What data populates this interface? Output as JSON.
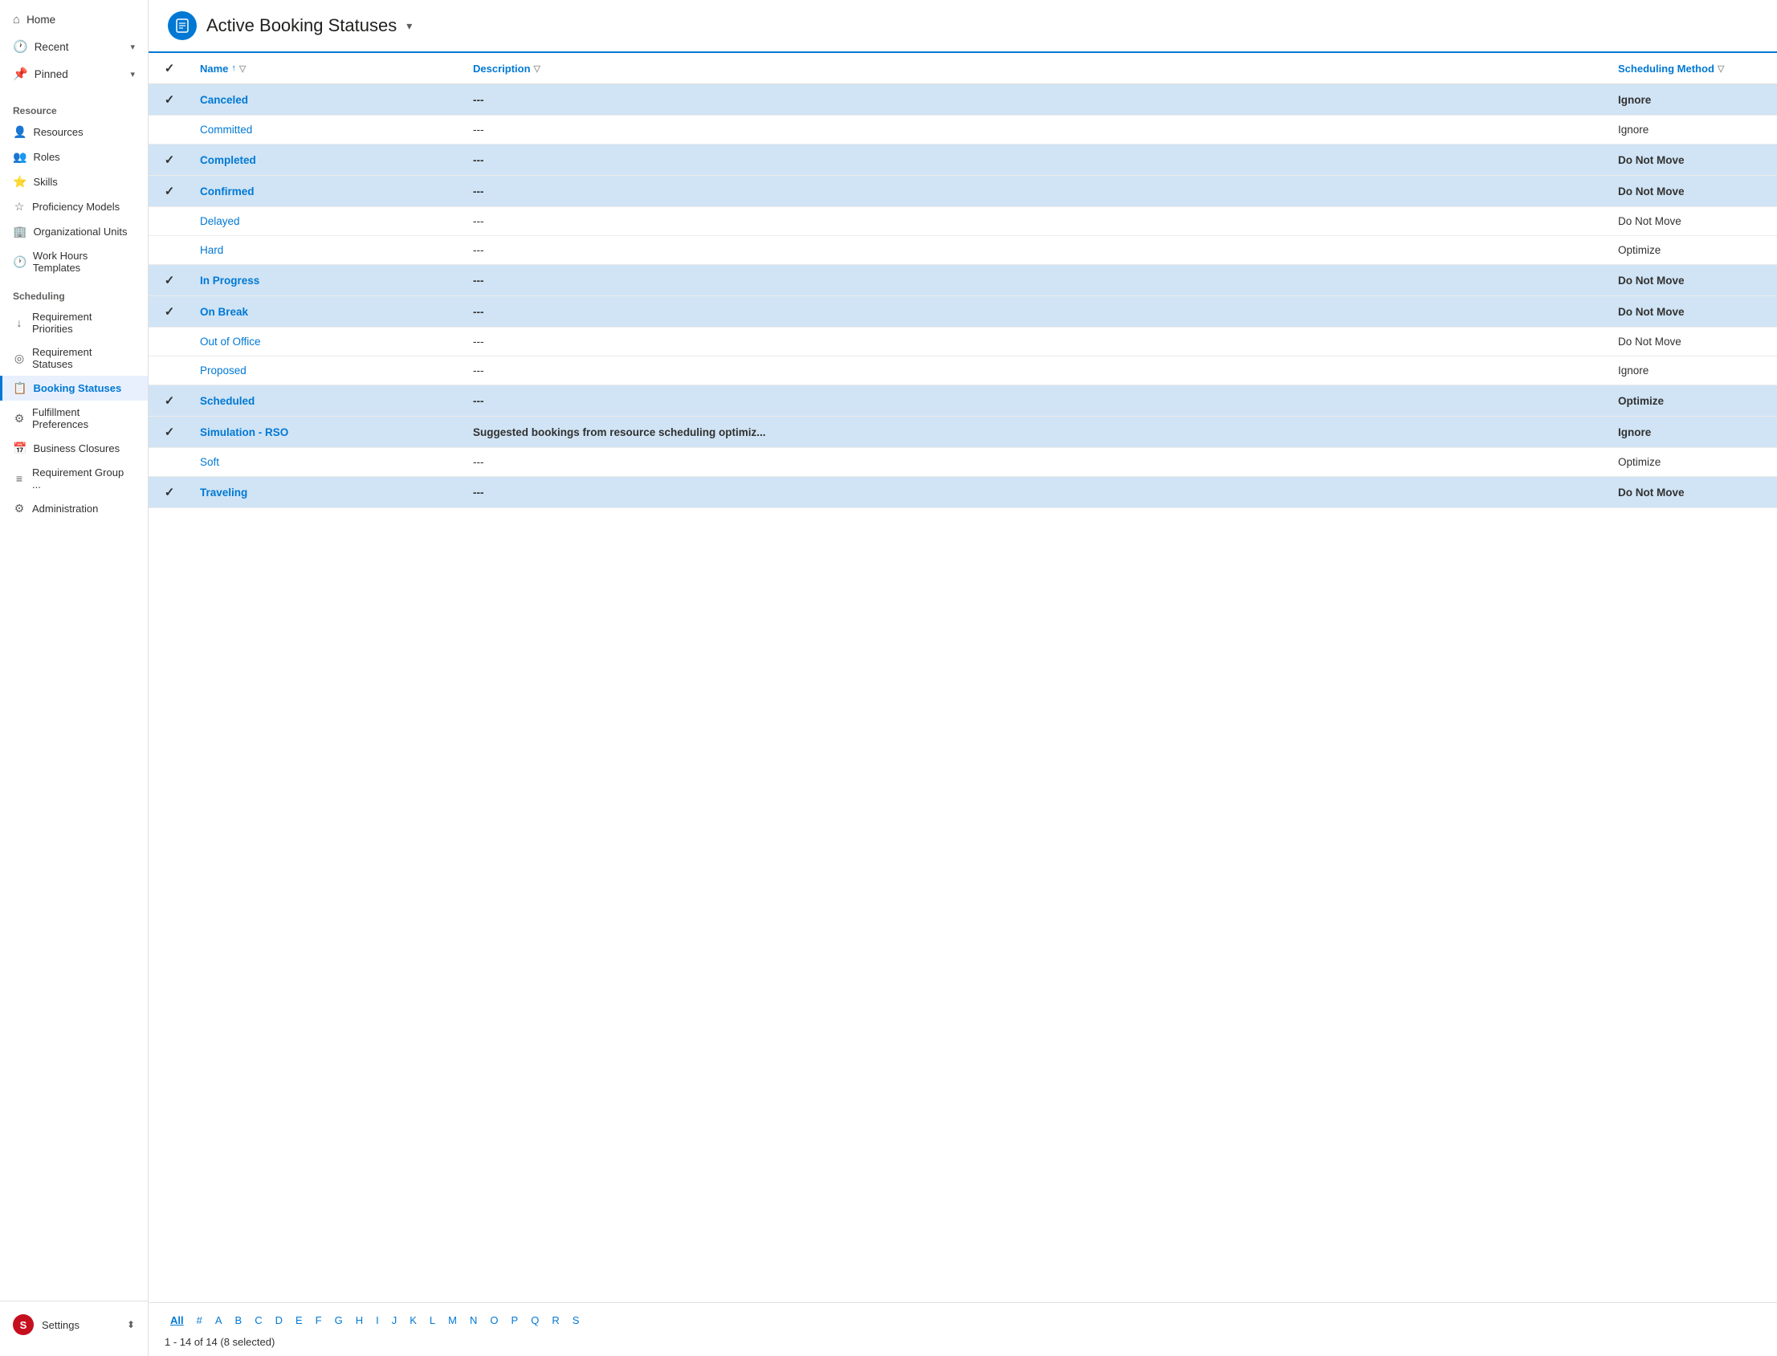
{
  "sidebar": {
    "nav": [
      {
        "id": "home",
        "label": "Home",
        "icon": "⌂",
        "hasChevron": false
      },
      {
        "id": "recent",
        "label": "Recent",
        "icon": "🕐",
        "hasChevron": true
      },
      {
        "id": "pinned",
        "label": "Pinned",
        "icon": "📌",
        "hasChevron": true
      }
    ],
    "sections": [
      {
        "id": "resource",
        "label": "Resource",
        "items": [
          {
            "id": "resources",
            "label": "Resources",
            "icon": "👤"
          },
          {
            "id": "roles",
            "label": "Roles",
            "icon": "👥"
          },
          {
            "id": "skills",
            "label": "Skills",
            "icon": "⭐"
          },
          {
            "id": "proficiency-models",
            "label": "Proficiency Models",
            "icon": "☆"
          },
          {
            "id": "organizational-units",
            "label": "Organizational Units",
            "icon": "🏢"
          },
          {
            "id": "work-hours-templates",
            "label": "Work Hours Templates",
            "icon": "🕐"
          }
        ]
      },
      {
        "id": "scheduling",
        "label": "Scheduling",
        "items": [
          {
            "id": "requirement-priorities",
            "label": "Requirement Priorities",
            "icon": "↓"
          },
          {
            "id": "requirement-statuses",
            "label": "Requirement Statuses",
            "icon": "◎"
          },
          {
            "id": "booking-statuses",
            "label": "Booking Statuses",
            "icon": "📋",
            "active": true
          },
          {
            "id": "fulfillment-preferences",
            "label": "Fulfillment Preferences",
            "icon": "⚙"
          },
          {
            "id": "business-closures",
            "label": "Business Closures",
            "icon": "📅"
          },
          {
            "id": "requirement-group",
            "label": "Requirement Group ...",
            "icon": "≡"
          },
          {
            "id": "administration",
            "label": "Administration",
            "icon": "⚙"
          }
        ]
      }
    ],
    "settings": {
      "label": "Settings",
      "avatar_letter": "S"
    }
  },
  "header": {
    "title": "Active Booking Statuses",
    "icon": "📋"
  },
  "table": {
    "columns": [
      {
        "id": "check",
        "label": "",
        "sortable": false,
        "filterable": false
      },
      {
        "id": "name",
        "label": "Name",
        "sortable": true,
        "filterable": true
      },
      {
        "id": "description",
        "label": "Description",
        "sortable": false,
        "filterable": true
      },
      {
        "id": "scheduling-method",
        "label": "Scheduling Method",
        "sortable": false,
        "filterable": true
      }
    ],
    "rows": [
      {
        "id": 1,
        "selected": true,
        "name": "Canceled",
        "description": "---",
        "scheduling_method": "Ignore"
      },
      {
        "id": 2,
        "selected": false,
        "name": "Committed",
        "description": "---",
        "scheduling_method": "Ignore"
      },
      {
        "id": 3,
        "selected": true,
        "name": "Completed",
        "description": "---",
        "scheduling_method": "Do Not Move"
      },
      {
        "id": 4,
        "selected": true,
        "name": "Confirmed",
        "description": "---",
        "scheduling_method": "Do Not Move"
      },
      {
        "id": 5,
        "selected": false,
        "name": "Delayed",
        "description": "---",
        "scheduling_method": "Do Not Move"
      },
      {
        "id": 6,
        "selected": false,
        "name": "Hard",
        "description": "---",
        "scheduling_method": "Optimize"
      },
      {
        "id": 7,
        "selected": true,
        "name": "In Progress",
        "description": "---",
        "scheduling_method": "Do Not Move"
      },
      {
        "id": 8,
        "selected": true,
        "name": "On Break",
        "description": "---",
        "scheduling_method": "Do Not Move"
      },
      {
        "id": 9,
        "selected": false,
        "name": "Out of Office",
        "description": "---",
        "scheduling_method": "Do Not Move"
      },
      {
        "id": 10,
        "selected": false,
        "name": "Proposed",
        "description": "---",
        "scheduling_method": "Ignore"
      },
      {
        "id": 11,
        "selected": true,
        "name": "Scheduled",
        "description": "---",
        "scheduling_method": "Optimize"
      },
      {
        "id": 12,
        "selected": true,
        "name": "Simulation - RSO",
        "description": "Suggested bookings from resource scheduling optimiz...",
        "scheduling_method": "Ignore"
      },
      {
        "id": 13,
        "selected": false,
        "name": "Soft",
        "description": "---",
        "scheduling_method": "Optimize"
      },
      {
        "id": 14,
        "selected": true,
        "name": "Traveling",
        "description": "---",
        "scheduling_method": "Do Not Move"
      }
    ]
  },
  "pagination": {
    "record_count": "1 - 14 of 14 (8 selected)",
    "alpha_items": [
      "All",
      "#",
      "A",
      "B",
      "C",
      "D",
      "E",
      "F",
      "G",
      "H",
      "I",
      "J",
      "K",
      "L",
      "M",
      "N",
      "O",
      "P",
      "Q",
      "R",
      "S"
    ],
    "active_alpha": "All"
  }
}
